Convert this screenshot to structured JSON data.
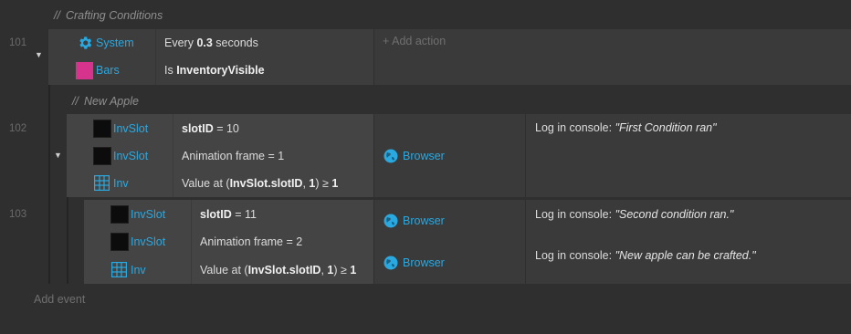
{
  "comments": {
    "crafting": "Crafting Conditions",
    "new_apple": "New Apple",
    "slashes": "//"
  },
  "events": {
    "e101": {
      "number": "101",
      "conditions": [
        {
          "object": "System",
          "icon": "gear-icon",
          "pre": "Every ",
          "bold": "0.3",
          "post": " seconds"
        },
        {
          "object": "Bars",
          "icon": "pink-square-icon",
          "pre": "Is ",
          "bold": "InventoryVisible",
          "post": ""
        }
      ],
      "add_action": "Add action",
      "add_action_plus": "+"
    },
    "e102": {
      "number": "102",
      "conditions": [
        {
          "object": "InvSlot",
          "pre": "",
          "bold": "slotID",
          "post": " = 10"
        },
        {
          "object": "InvSlot",
          "pre": "Animation frame = 1",
          "bold": "",
          "post": ""
        },
        {
          "object": "Inv",
          "pre": "Value at (",
          "bold": "InvSlot.slotID",
          "post": ", ",
          "bold2": "1",
          "post2": ") ≥ ",
          "bold3": "1"
        }
      ],
      "actions": [
        {
          "object": "Browser",
          "text": "Log in console: ",
          "quote": "\"First Condition ran\""
        }
      ]
    },
    "e103": {
      "number": "103",
      "conditions": [
        {
          "object": "InvSlot",
          "pre": "",
          "bold": "slotID",
          "post": " = 11"
        },
        {
          "object": "InvSlot",
          "pre": "Animation frame = 2",
          "bold": "",
          "post": ""
        },
        {
          "object": "Inv",
          "pre": "Value at (",
          "bold": "InvSlot.slotID",
          "post": ", ",
          "bold2": "1",
          "post2": ") ≥ ",
          "bold3": "1"
        }
      ],
      "actions": [
        {
          "object": "Browser",
          "text": "Log in console: ",
          "quote": "\"Second condition ran.\""
        },
        {
          "object": "Browser",
          "text": "Log in console: ",
          "quote": "\"New apple can be crafted.\""
        }
      ]
    }
  },
  "add_event": "Add event",
  "colors": {
    "object_link": "#2aa8e0",
    "bars": "#d6338c",
    "background": "#2f2f2f"
  }
}
